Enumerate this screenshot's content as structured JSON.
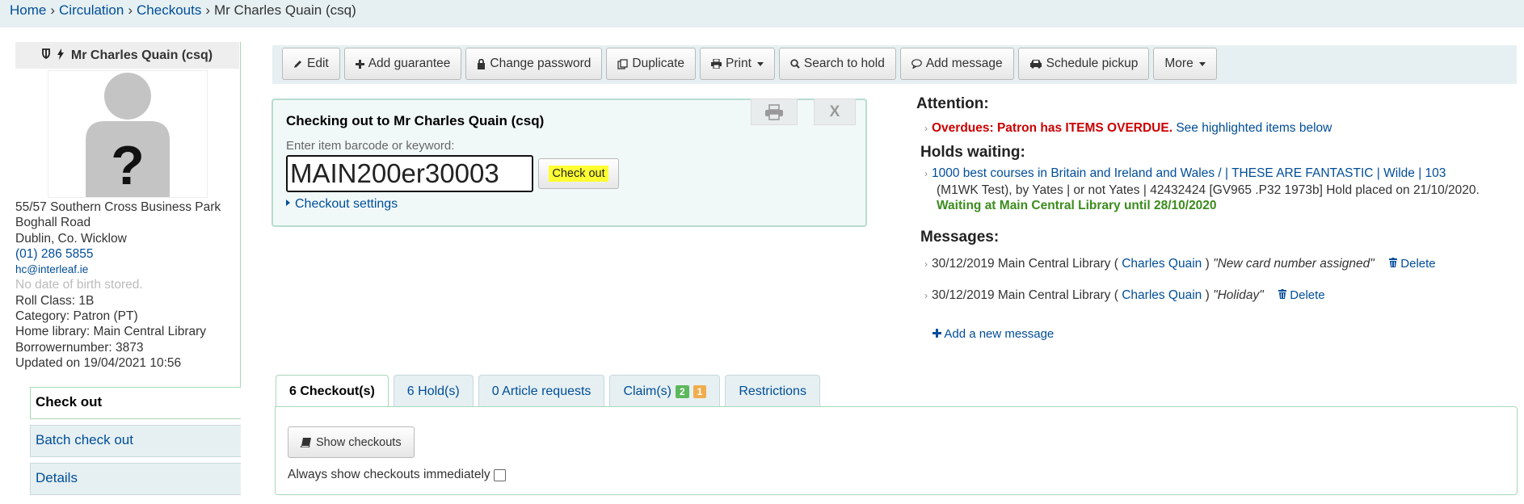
{
  "breadcrumb": [
    "Home",
    "Circulation",
    "Checkouts",
    "Mr Charles Quain (csq)"
  ],
  "patron": {
    "name": "Mr Charles Quain (csq)",
    "address": [
      "55/57 Southern Cross Business Park",
      "Boghall Road",
      "Dublin, Co. Wicklow"
    ],
    "phone": "(01) 286 5855",
    "email": "hc@interleaf.ie",
    "dob": "No date of birth stored.",
    "roll_class": "Roll Class: 1B",
    "category": "Category: Patron (PT)",
    "home_library": "Home library: Main Central Library",
    "borrowernumber": "Borrowernumber: 3873",
    "updated": "Updated on 19/04/2021 10:56"
  },
  "sidenav": [
    "Check out",
    "Batch check out",
    "Details"
  ],
  "toolbar": [
    "Edit",
    "Add guarantee",
    "Change password",
    "Duplicate",
    "Print",
    "Search to hold",
    "Add message",
    "Schedule pickup",
    "More"
  ],
  "checkout": {
    "title": "Checking out to Mr Charles Quain (csq)",
    "label": "Enter item barcode or keyword:",
    "value": "MAIN200er30003",
    "button": "Check out",
    "settings": "Checkout settings"
  },
  "attention": {
    "heading": "Attention:",
    "overdue": "Overdues: Patron has ITEMS OVERDUE.",
    "overdue_link": "See highlighted items below",
    "holds_heading": "Holds waiting:",
    "hold_link": "1000 best courses in Britain and Ireland and Wales / | THESE ARE FANTASTIC | Wilde | 103",
    "hold_detail": "(M1WK Test), by Yates | or not Yates | 42432424 [GV965 .P32 1973b] Hold placed on 21/10/2020.",
    "hold_waiting": "Waiting at Main Central Library until 28/10/2020",
    "messages_heading": "Messages:",
    "messages": [
      {
        "date": "30/12/2019 Main Central Library (",
        "author": "Charles Quain",
        "close": ")",
        "text": "\"New card number assigned\"",
        "delete": "Delete"
      },
      {
        "date": "30/12/2019 Main Central Library (",
        "author": "Charles Quain",
        "close": ")",
        "text": "\"Holiday\"",
        "delete": "Delete"
      }
    ],
    "add_message": "Add a new message"
  },
  "tabs": {
    "checkouts": "6 Checkout(s)",
    "holds": "6 Hold(s)",
    "articles": "0 Article requests",
    "claims": "Claim(s)",
    "claims_badge_green": "2",
    "claims_badge_orange": "1",
    "restrictions": "Restrictions"
  },
  "panel": {
    "show_button": "Show checkouts",
    "always_label": "Always show checkouts immediately"
  }
}
